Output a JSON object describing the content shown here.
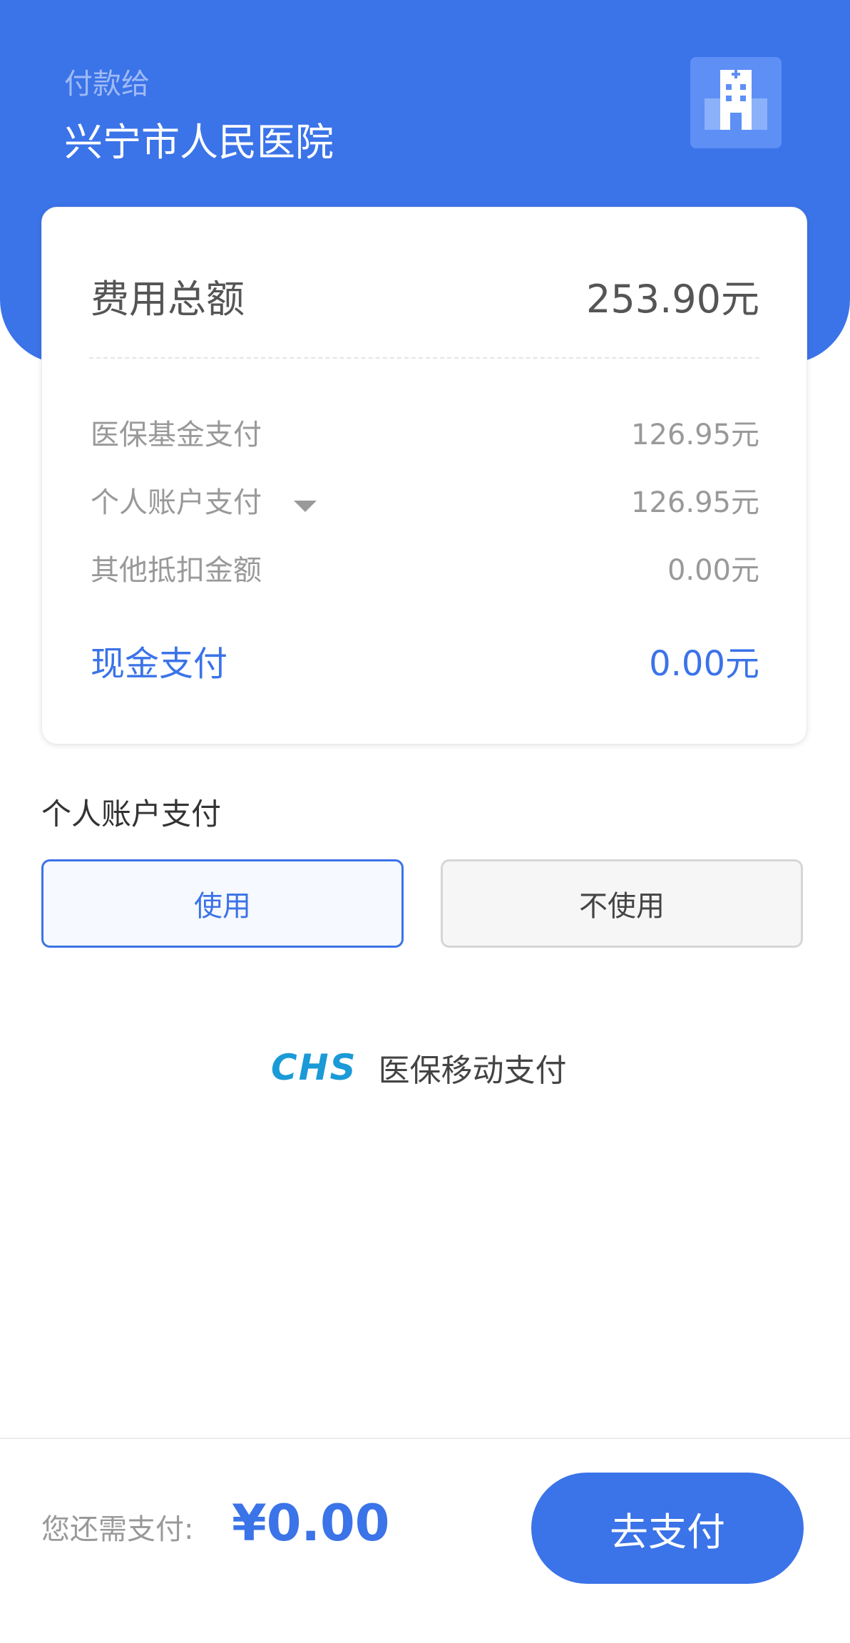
{
  "header": {
    "payee_label": "付款给",
    "payee_name": "兴宁市人民医院",
    "badge_icon": "hospital-icon",
    "background_color": "#3b73e8"
  },
  "summary": {
    "total_label": "费用总额",
    "total_value": "253.90元",
    "fund_label": "医保基金支付",
    "fund_value": "126.95元",
    "personal_label": "个人账户支付",
    "personal_value": "126.95元",
    "personal_caret_icon": "caret-down-icon",
    "other_label": "其他抵扣金额",
    "other_value": "0.00元",
    "cash_label": "现金支付",
    "cash_value": "0.00元"
  },
  "personal_account": {
    "section_label": "个人账户支付",
    "use_label": "使用",
    "not_use_label": "不使用",
    "selected": "使用"
  },
  "brand": {
    "logo_text": "CHS",
    "name": "医保移动支付"
  },
  "footer": {
    "due_label": "您还需支付:",
    "due_amount": "¥0.00",
    "pay_button": "去支付"
  }
}
